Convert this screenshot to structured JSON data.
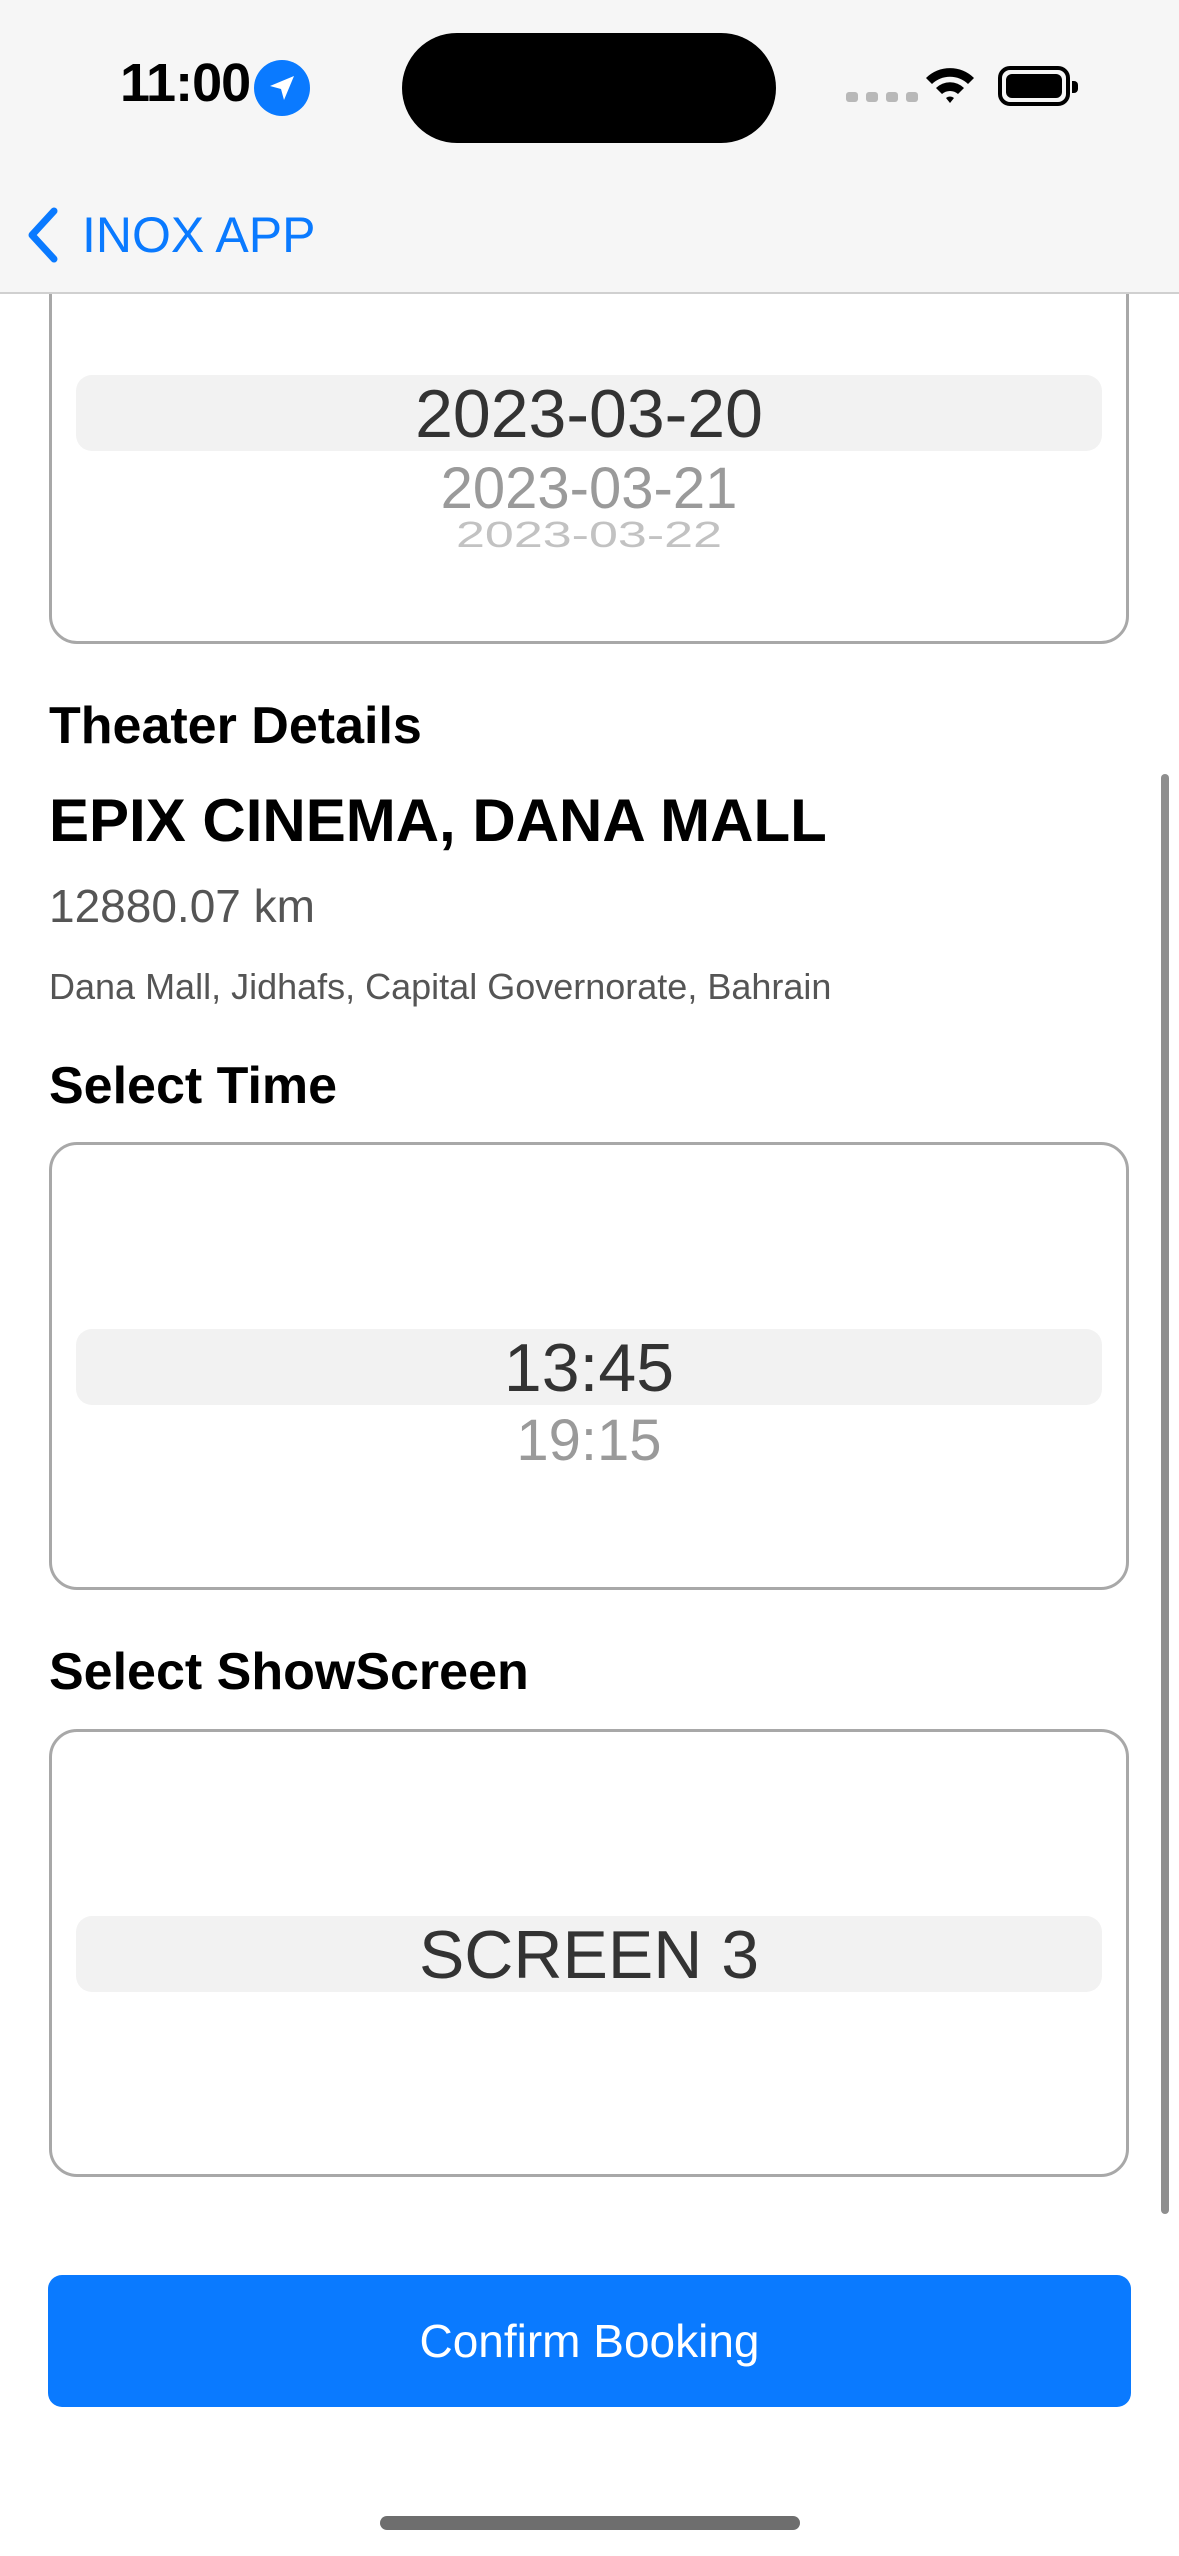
{
  "status_bar": {
    "time": "11:00"
  },
  "nav": {
    "back_label": "INOX APP"
  },
  "date_picker": {
    "selected": "2023-03-20",
    "next": "2023-03-21",
    "after": "2023-03-22"
  },
  "theater": {
    "heading": "Theater Details",
    "name": "EPIX CINEMA, DANA MALL",
    "distance": "12880.07 km",
    "address": "Dana Mall, Jidhafs, Capital Governorate, Bahrain"
  },
  "time_section": {
    "heading": "Select Time",
    "selected": "13:45",
    "next": "19:15"
  },
  "screen_section": {
    "heading": "Select ShowScreen",
    "selected": "SCREEN 3"
  },
  "confirm_label": "Confirm Booking",
  "colors": {
    "accent": "#0a7aff"
  }
}
